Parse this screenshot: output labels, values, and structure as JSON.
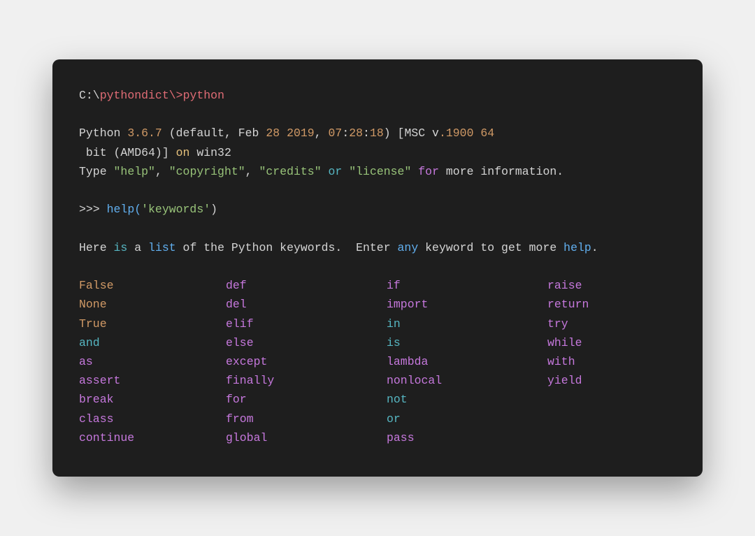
{
  "prompt": {
    "path_prefix": "C:\\",
    "dir": "pythondict",
    "sep": "\\>",
    "cmd": "python"
  },
  "banner": {
    "l1": {
      "pre": "Python ",
      "ver": "3.6.7",
      "mid": " (default, Feb ",
      "day": "28",
      "sp1": " ",
      "year": "2019",
      "comma": ", ",
      "h": "07",
      "colon1": ":",
      "m": "28",
      "colon2": ":",
      "s": "18",
      "post1": ") [MSC v",
      "dot": ".1900",
      "sp2": " ",
      "bits": "64"
    },
    "l2": {
      "pre": " bit (AMD64)] ",
      "on": "on",
      "post": " win32"
    },
    "l3": {
      "t1": "Type ",
      "s1": "\"help\"",
      "c1": ", ",
      "s2": "\"copyright\"",
      "c2": ", ",
      "s3": "\"credits\"",
      "sp1": " ",
      "or": "or",
      "sp2": " ",
      "s4": "\"license\"",
      "sp3": " ",
      "for": "for",
      "t2": " more information."
    }
  },
  "repl": {
    "prompt": ">>> ",
    "call": "help(",
    "arg": "'keywords'",
    "close": ")"
  },
  "hint": {
    "t1": "Here ",
    "is": "is",
    "t2": " a ",
    "list": "list",
    "t3": " of the Python keywords.  Enter ",
    "any": "any",
    "t4": " keyword to get more ",
    "help": "help",
    "t5": "."
  },
  "keywords": [
    [
      {
        "w": "False",
        "c": "c-orange"
      },
      {
        "w": "None",
        "c": "c-orange"
      },
      {
        "w": "True",
        "c": "c-orange"
      },
      {
        "w": "and",
        "c": "c-cyan"
      },
      {
        "w": "as",
        "c": "c-purple"
      },
      {
        "w": "assert",
        "c": "c-purple"
      },
      {
        "w": "break",
        "c": "c-purple"
      },
      {
        "w": "class",
        "c": "c-purple"
      },
      {
        "w": "continue",
        "c": "c-purple"
      }
    ],
    [
      {
        "w": "def",
        "c": "c-purple"
      },
      {
        "w": "del",
        "c": "c-purple"
      },
      {
        "w": "elif",
        "c": "c-purple"
      },
      {
        "w": "else",
        "c": "c-purple"
      },
      {
        "w": "except",
        "c": "c-purple"
      },
      {
        "w": "finally",
        "c": "c-purple"
      },
      {
        "w": "for",
        "c": "c-purple"
      },
      {
        "w": "from",
        "c": "c-purple"
      },
      {
        "w": "global",
        "c": "c-purple"
      }
    ],
    [
      {
        "w": "if",
        "c": "c-purple"
      },
      {
        "w": "import",
        "c": "c-purple"
      },
      {
        "w": "in",
        "c": "c-cyan"
      },
      {
        "w": "is",
        "c": "c-cyan"
      },
      {
        "w": "lambda",
        "c": "c-purple"
      },
      {
        "w": "nonlocal",
        "c": "c-purple"
      },
      {
        "w": "not",
        "c": "c-cyan"
      },
      {
        "w": "or",
        "c": "c-cyan"
      },
      {
        "w": "pass",
        "c": "c-purple"
      }
    ],
    [
      {
        "w": "raise",
        "c": "c-purple"
      },
      {
        "w": "return",
        "c": "c-purple"
      },
      {
        "w": "try",
        "c": "c-purple"
      },
      {
        "w": "while",
        "c": "c-purple"
      },
      {
        "w": "with",
        "c": "c-purple"
      },
      {
        "w": "yield",
        "c": "c-purple"
      }
    ]
  ]
}
